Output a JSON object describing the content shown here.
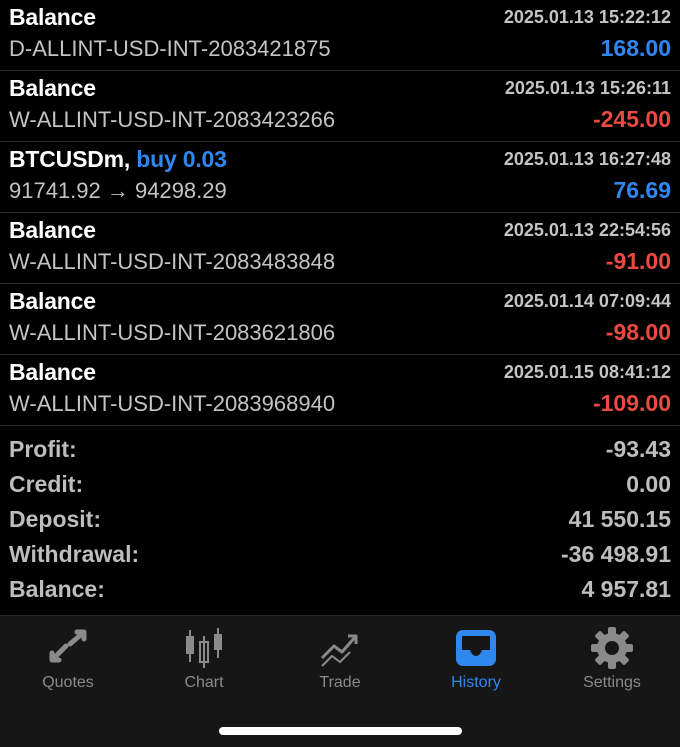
{
  "colors": {
    "positive": "#2f87f0",
    "negative": "#ea4a3f",
    "background": "#000000",
    "tabbar_bg": "#161616",
    "active_tab": "#2f87f0",
    "inactive_tab": "#8a8a8a"
  },
  "history": [
    {
      "title": "Balance",
      "side": "",
      "time": "2025.01.13 15:22:12",
      "detail": "D-ALLINT-USD-INT-2083421875",
      "amount": "168.00",
      "amount_kind": "positive"
    },
    {
      "title": "Balance",
      "side": "",
      "time": "2025.01.13 15:26:11",
      "detail": "W-ALLINT-USD-INT-2083423266",
      "amount": "-245.00",
      "amount_kind": "negative"
    },
    {
      "title": "BTCUSDm,",
      "side": "buy 0.03",
      "time": "2025.01.13 16:27:48",
      "detail": "91741.92 → 94298.29",
      "amount": "76.69",
      "amount_kind": "positive"
    },
    {
      "title": "Balance",
      "side": "",
      "time": "2025.01.13 22:54:56",
      "detail": "W-ALLINT-USD-INT-2083483848",
      "amount": "-91.00",
      "amount_kind": "negative"
    },
    {
      "title": "Balance",
      "side": "",
      "time": "2025.01.14 07:09:44",
      "detail": "W-ALLINT-USD-INT-2083621806",
      "amount": "-98.00",
      "amount_kind": "negative"
    },
    {
      "title": "Balance",
      "side": "",
      "time": "2025.01.15 08:41:12",
      "detail": "W-ALLINT-USD-INT-2083968940",
      "amount": "-109.00",
      "amount_kind": "negative"
    }
  ],
  "summary": {
    "profit_label": "Profit:",
    "profit_value": "-93.43",
    "credit_label": "Credit:",
    "credit_value": "0.00",
    "deposit_label": "Deposit:",
    "deposit_value": "41 550.15",
    "withdrawal_label": "Withdrawal:",
    "withdrawal_value": "-36 498.91",
    "balance_label": "Balance:",
    "balance_value": "4 957.81"
  },
  "tabs": [
    {
      "label": "Quotes",
      "icon": "quotes-arrows-icon",
      "active": false
    },
    {
      "label": "Chart",
      "icon": "candlestick-chart-icon",
      "active": false
    },
    {
      "label": "Trade",
      "icon": "trade-trend-icon",
      "active": false
    },
    {
      "label": "History",
      "icon": "history-inbox-icon",
      "active": true
    },
    {
      "label": "Settings",
      "icon": "gear-icon",
      "active": false
    }
  ]
}
